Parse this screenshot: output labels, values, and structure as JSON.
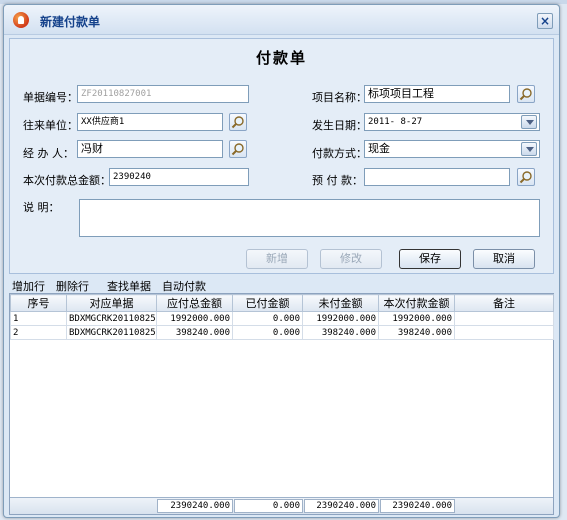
{
  "dialog": {
    "title": "新建付款单",
    "close_label": "×"
  },
  "form": {
    "heading": "付款单",
    "doc_no_label": "单据编号：",
    "doc_no_value": "ZF20110827001",
    "project_label": "项目名称：",
    "project_value": "标项项目工程",
    "vendor_label": "往来单位：",
    "vendor_value": "XX供应商1",
    "date_label": "发生日期：",
    "date_value": "2011- 8-27",
    "handler_label": "经 办 人：",
    "handler_value": "冯财",
    "method_label": "付款方式：",
    "method_value": "现金",
    "total_label": "本次付款总金额：",
    "total_value": "2390240",
    "prepay_label": "预 付 款：",
    "prepay_value": "",
    "note_label": "说    明："
  },
  "buttons": {
    "add": "新增",
    "edit": "修改",
    "save": "保存",
    "cancel": "取消"
  },
  "toolbar": {
    "add_row": "增加行",
    "delete_row": "删除行",
    "find_doc": "查找单据",
    "auto_pay": "自动付款"
  },
  "table": {
    "columns": [
      "序号",
      "对应单据",
      "应付总金额",
      "已付金额",
      "未付金额",
      "本次付款金额",
      "备注"
    ],
    "rows": [
      [
        "1",
        "BDXMGCRK20110825",
        "1992000.000",
        "0.000",
        "1992000.000",
        "1992000.000",
        ""
      ],
      [
        "2",
        "BDXMGCRK20110825",
        "398240.000",
        "0.000",
        "398240.000",
        "398240.000",
        ""
      ]
    ],
    "totals": [
      "2390240.000",
      "0.000",
      "2390240.000",
      "2390240.000"
    ]
  },
  "icons": [
    "app-icon",
    "close-icon",
    "magnifier-icon",
    "dropdown-arrow-icon"
  ]
}
